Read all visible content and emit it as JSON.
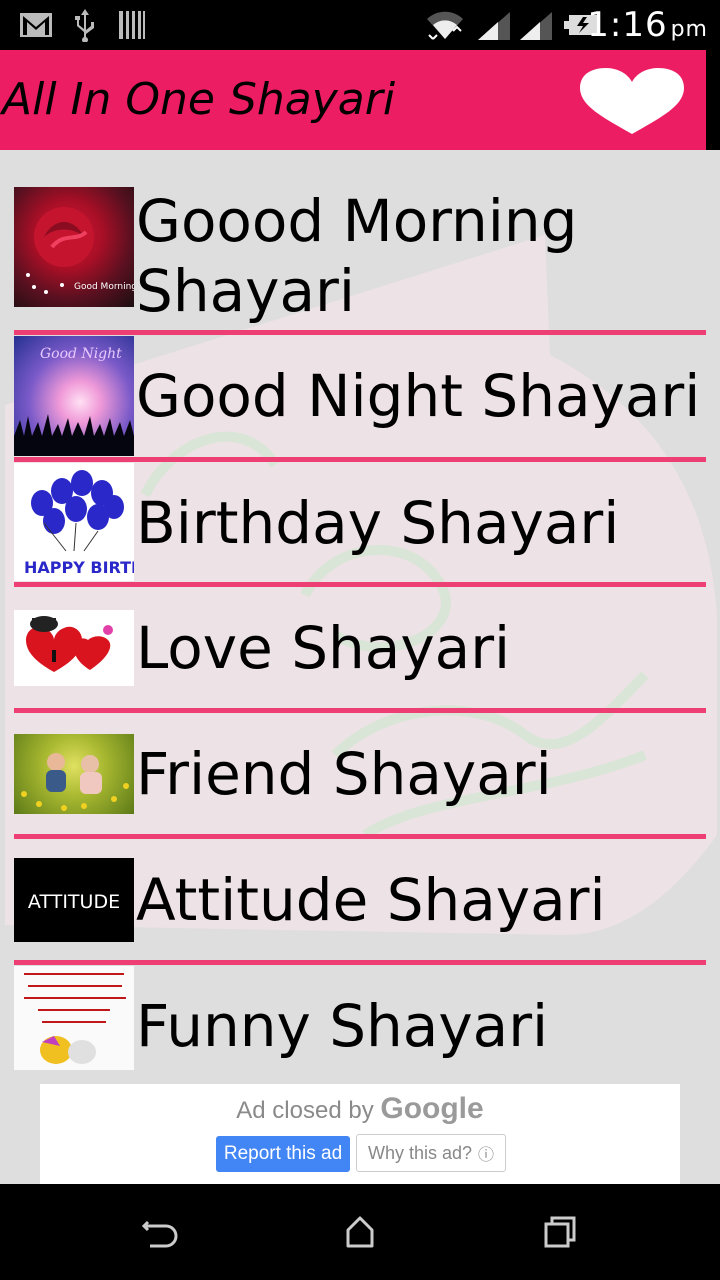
{
  "status_bar": {
    "time": "1:16",
    "ampm": "pm",
    "icons": [
      "gmail-icon",
      "usb-icon",
      "storage-icon",
      "wifi-icon",
      "signal-icon",
      "signal-icon-2",
      "battery-icon"
    ]
  },
  "app_bar": {
    "title": "All In One Shayari",
    "favorite_icon": "heart-icon"
  },
  "list": {
    "items": [
      {
        "label": "Goood Morning Shayari",
        "line1": "Goood Morning",
        "line2": "Shayari",
        "thumb_text": "Good Morning"
      },
      {
        "label": "Good Night Shayari",
        "thumb_text": "Good Night"
      },
      {
        "label": "Birthday Shayari",
        "thumb_text": "HAPPY BIRTHDAY"
      },
      {
        "label": "Love Shayari"
      },
      {
        "label": "Friend Shayari"
      },
      {
        "label": "Attitude Shayari",
        "thumb_text": "ATTITUDE"
      },
      {
        "label": "Funny Shayari"
      }
    ]
  },
  "ad": {
    "closed_text": "Ad closed by",
    "brand": "Google",
    "report_button": "Report this ad",
    "why_button": "Why this ad?"
  },
  "nav_bar": {
    "icons": [
      "back-icon",
      "home-icon",
      "recents-icon"
    ]
  },
  "colors": {
    "accent": "#ec1d63",
    "divider": "#ee3f75",
    "background": "#dedede"
  }
}
